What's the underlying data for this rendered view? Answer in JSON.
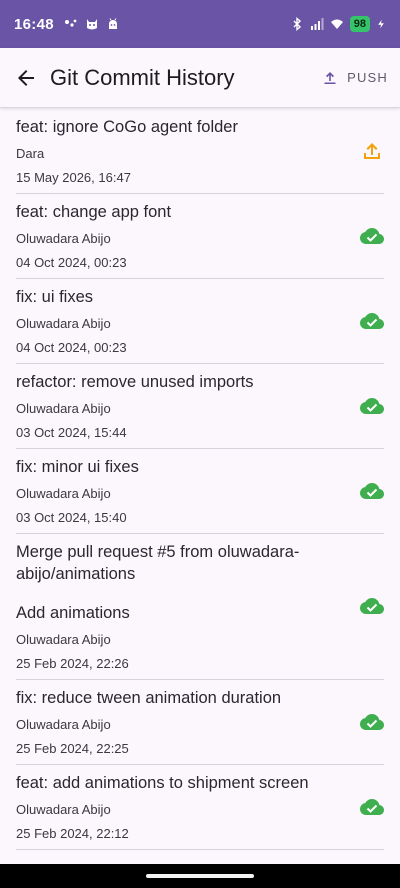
{
  "status_bar": {
    "time": "16:48",
    "battery": "98",
    "notification_icons": [
      "dots-icon",
      "cat-icon",
      "android-icon"
    ],
    "system_icons": [
      "bluetooth-icon",
      "signal-icon",
      "wifi-icon"
    ]
  },
  "app_bar": {
    "title": "Git Commit History",
    "push_label": "PUSH",
    "back_icon": "arrow-back-icon",
    "push_icon": "upload-icon"
  },
  "colors": {
    "status_bar": "#6a54a5",
    "background": "#fcf6fd",
    "synced": "#3fae4f",
    "pending": "#f2a20f"
  },
  "commits": [
    {
      "message": "feat: ignore CoGo agent folder",
      "author": "Dara",
      "date": "15 May 2026, 16:47",
      "status": "pending"
    },
    {
      "message": "feat: change app font",
      "author": "Oluwadara Abijo",
      "date": "04 Oct 2024, 00:23",
      "status": "synced"
    },
    {
      "message": "fix: ui fixes",
      "author": "Oluwadara Abijo",
      "date": "04 Oct 2024, 00:23",
      "status": "synced"
    },
    {
      "message": "refactor: remove unused imports",
      "author": "Oluwadara Abijo",
      "date": "03 Oct 2024, 15:44",
      "status": "synced"
    },
    {
      "message": "fix: minor ui fixes",
      "author": "Oluwadara Abijo",
      "date": "03 Oct 2024, 15:40",
      "status": "synced"
    },
    {
      "message": "Merge pull request #5 from oluwadara-abijo/animations",
      "message_body": "Add animations",
      "author": "Oluwadara Abijo",
      "date": "25 Feb 2024, 22:26",
      "status": "synced"
    },
    {
      "message": "fix: reduce tween animation duration",
      "author": "Oluwadara Abijo",
      "date": "25 Feb 2024, 22:25",
      "status": "synced"
    },
    {
      "message": "feat: add animations to shipment screen",
      "author": "Oluwadara Abijo",
      "date": "25 Feb 2024, 22:12",
      "status": "synced"
    }
  ]
}
